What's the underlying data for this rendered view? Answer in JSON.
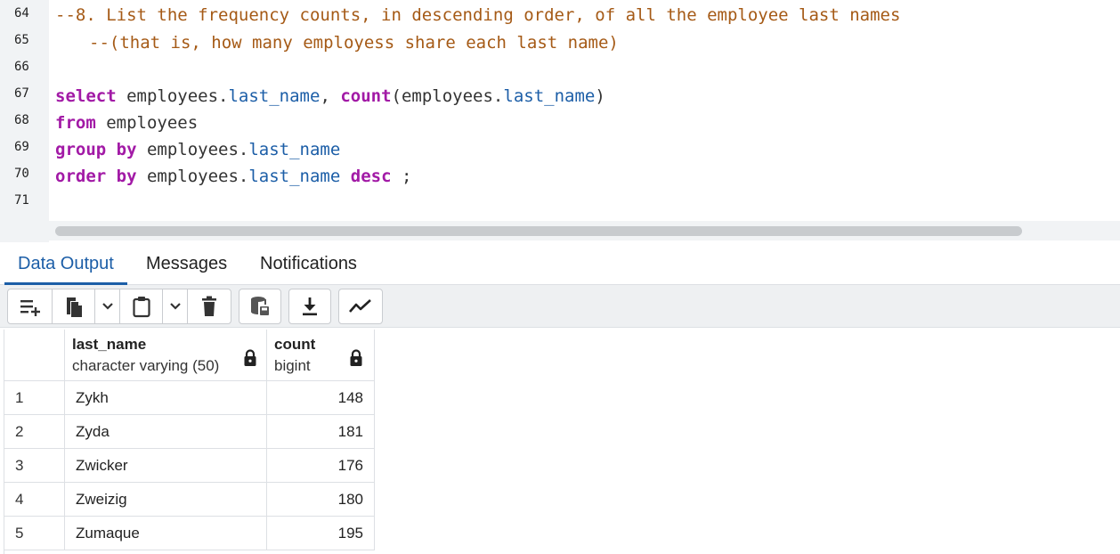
{
  "editor": {
    "line_numbers": [
      "64",
      "65",
      "66",
      "67",
      "68",
      "69",
      "70",
      "71"
    ],
    "comment_line_1": "--8. List the frequency counts, in descending order, of all the employee last names",
    "comment_line_2": "--(that is, how many employess share each last name)",
    "line67": {
      "kw_select": "select",
      "t1": " employees.",
      "f1": "last_name",
      "t2": ", ",
      "kw_count": "count",
      "t3": "(employees.",
      "f2": "last_name",
      "t4": ")"
    },
    "line68": {
      "kw_from": "from",
      "t1": " employees"
    },
    "line69": {
      "kw_group": "group by",
      "t1": " employees.",
      "f1": "last_name"
    },
    "line70": {
      "kw_order": "order by",
      "t1": " employees.",
      "f1": "last_name",
      "t2": " ",
      "kw_desc": "desc",
      "t3": " ;"
    }
  },
  "tabs": [
    {
      "label": "Data Output",
      "active": true
    },
    {
      "label": "Messages",
      "active": false
    },
    {
      "label": "Notifications",
      "active": false
    }
  ],
  "toolbar": {
    "icons": [
      "add-row-icon",
      "copy-icon",
      "chevron-down-icon",
      "paste-icon",
      "chevron-down-icon",
      "delete-icon",
      "save-data-icon",
      "download-icon",
      "graph-icon"
    ]
  },
  "grid": {
    "columns": [
      {
        "name": "last_name",
        "type": "character varying (50)",
        "locked": true
      },
      {
        "name": "count",
        "type": "bigint",
        "locked": true
      }
    ],
    "rows": [
      {
        "num": "1",
        "last_name": "Zykh",
        "count": "148"
      },
      {
        "num": "2",
        "last_name": "Zyda",
        "count": "181"
      },
      {
        "num": "3",
        "last_name": "Zwicker",
        "count": "176"
      },
      {
        "num": "4",
        "last_name": "Zweizig",
        "count": "180"
      },
      {
        "num": "5",
        "last_name": "Zumaque",
        "count": "195"
      }
    ]
  },
  "colors": {
    "keyword": "#a21aa6",
    "comment": "#a55a16",
    "field": "#1c5ea7",
    "accent": "#1c5ea7"
  }
}
